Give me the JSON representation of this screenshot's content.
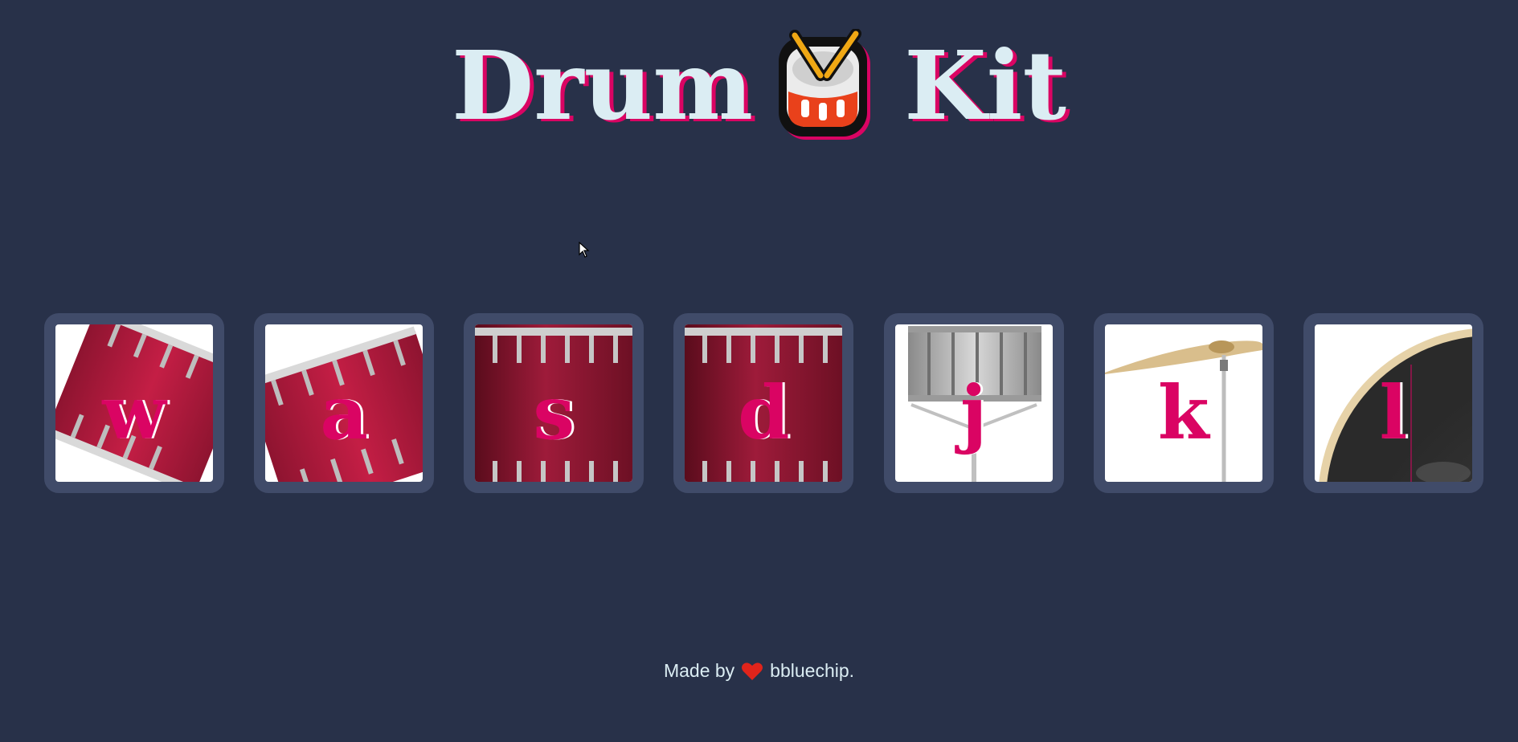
{
  "header": {
    "title_word_1": "Drum",
    "title_word_2": "Kit",
    "emoji_icon": "drum-icon"
  },
  "keys": [
    {
      "letter": "w",
      "instrument_icon": "tom-drum-tilted-left-icon"
    },
    {
      "letter": "a",
      "instrument_icon": "tom-drum-tilted-right-icon"
    },
    {
      "letter": "s",
      "instrument_icon": "floor-tom-icon"
    },
    {
      "letter": "d",
      "instrument_icon": "floor-tom-icon"
    },
    {
      "letter": "j",
      "instrument_icon": "snare-drum-icon"
    },
    {
      "letter": "k",
      "instrument_icon": "crash-cymbal-icon"
    },
    {
      "letter": "l",
      "instrument_icon": "bass-drum-icon"
    }
  ],
  "footer": {
    "prefix": "Made by",
    "heart_icon": "heart-icon",
    "author": "bbluechip."
  },
  "colors": {
    "background": "#283149",
    "key_border": "#404b69",
    "accent": "#da0463",
    "title_text": "#dbedf3"
  }
}
